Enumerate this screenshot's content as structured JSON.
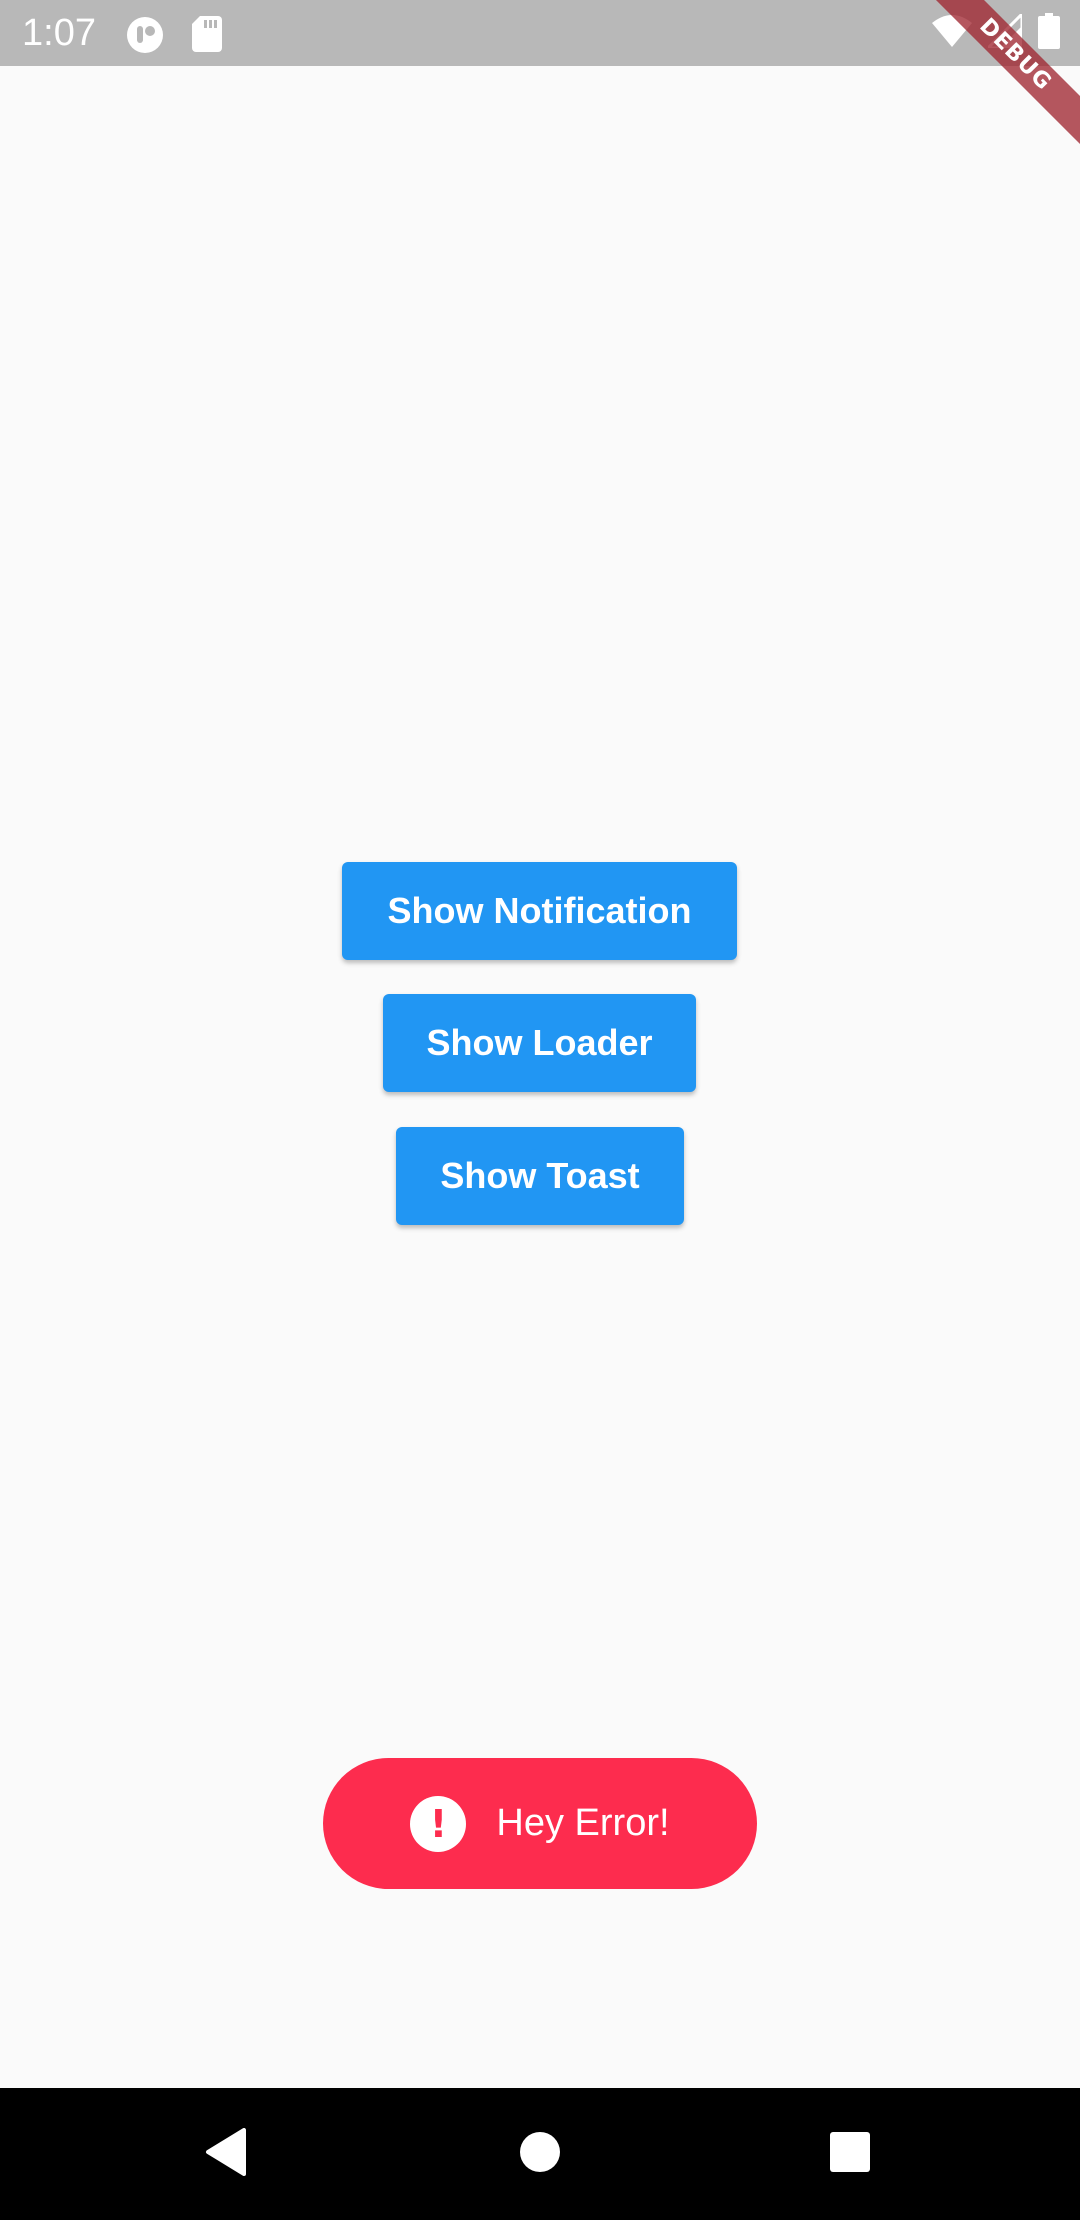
{
  "status_bar": {
    "time": "1:07",
    "left_icons": [
      "app-notification-icon",
      "sd-card-icon"
    ],
    "right_icons": [
      "wifi-icon",
      "cell-signal-icon",
      "battery-icon"
    ]
  },
  "debug_banner": {
    "label": "DEBUG"
  },
  "buttons": {
    "notification_label": "Show Notification",
    "loader_label": "Show Loader",
    "toast_label": "Show Toast"
  },
  "toast": {
    "icon_glyph": "!",
    "message": "Hey Error!"
  },
  "nav_bar": {
    "icons": [
      "back-icon",
      "home-icon",
      "recents-icon"
    ]
  },
  "colors": {
    "status_bar_bg": "#b8b8b8",
    "page_bg": "#fafafa",
    "button_bg": "#2196f3",
    "toast_bg": "#fd2c4e",
    "nav_bar_bg": "#000000"
  }
}
